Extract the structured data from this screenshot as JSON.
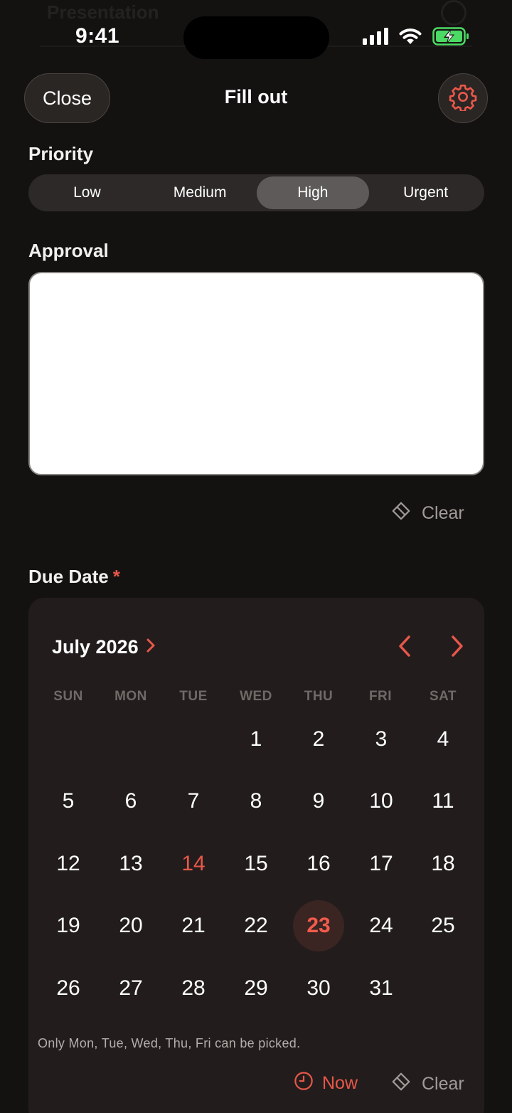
{
  "background": {
    "ghost_title": "Presentation"
  },
  "status_bar": {
    "time": "9:41",
    "icons": [
      "signal-icon",
      "wifi-icon",
      "battery-charging-icon"
    ]
  },
  "header": {
    "close_label": "Close",
    "title": "Fill out",
    "settings_icon": "gear-icon"
  },
  "priority": {
    "label": "Priority",
    "options": [
      "Low",
      "Medium",
      "High",
      "Urgent"
    ],
    "selected": "High"
  },
  "approval": {
    "label": "Approval",
    "clear_label": "Clear"
  },
  "due_date": {
    "label": "Due Date",
    "required_mark": "*",
    "month_label": "July 2026",
    "weekdays": [
      "SUN",
      "MON",
      "TUE",
      "WED",
      "THU",
      "FRI",
      "SAT"
    ],
    "first_weekday_index": 3,
    "days_in_month": 31,
    "today": 14,
    "selected": 23,
    "note": "Only Mon, Tue, Wed, Thu, Fri can be picked.",
    "now_label": "Now",
    "clear_label": "Clear"
  },
  "colors": {
    "accent": "#e8574a",
    "background": "#141211",
    "card": "#221d1c"
  }
}
